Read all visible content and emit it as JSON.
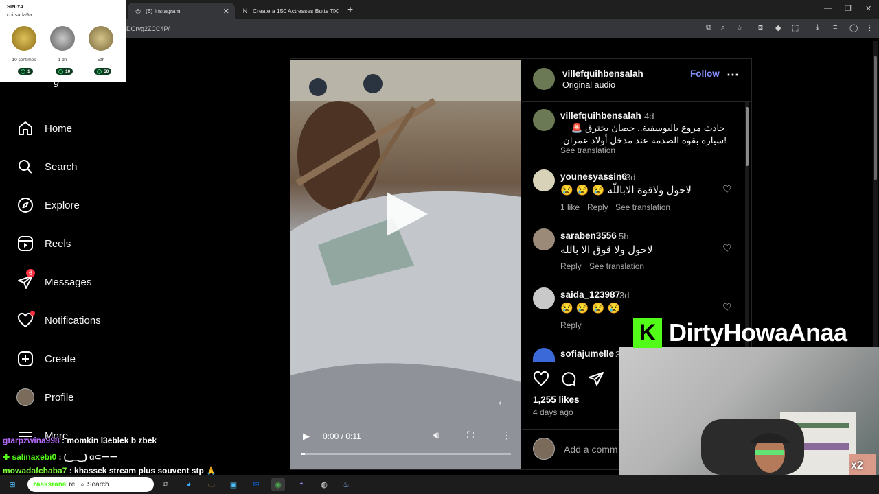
{
  "browser": {
    "tabs": [
      {
        "title": "(6) Instagram",
        "icon": "instagram-icon"
      },
      {
        "title": "Create a 150 Actresses Butts Ti",
        "icon": "notion-icon"
      }
    ],
    "url": "DOrvg2ZCC4P/"
  },
  "coins_overlay": {
    "title": "SINIYA",
    "subtitle": "chi sada9a",
    "coins": [
      {
        "label": "10 centimes",
        "count": "1",
        "color": "#c9a227"
      },
      {
        "label": "1 dh",
        "count": "10",
        "color": "#9a9a9a"
      },
      {
        "label": "5dh",
        "count": "50",
        "color": "#b8a36a"
      }
    ]
  },
  "sidebar": {
    "partial_logo": "g",
    "items": [
      {
        "label": "Home",
        "icon": "home-icon"
      },
      {
        "label": "Search",
        "icon": "search-icon"
      },
      {
        "label": "Explore",
        "icon": "compass-icon"
      },
      {
        "label": "Reels",
        "icon": "reels-icon"
      },
      {
        "label": "Messages",
        "icon": "send-icon",
        "badge": "6"
      },
      {
        "label": "Notifications",
        "icon": "heart-icon"
      },
      {
        "label": "Create",
        "icon": "plus-square-icon"
      },
      {
        "label": "Profile",
        "icon": "avatar"
      },
      {
        "label": "More",
        "icon": "menu-icon"
      }
    ]
  },
  "video": {
    "time": "0:00 / 0:11",
    "progress": 0.01
  },
  "post": {
    "author": "villefquihbensalah",
    "audio": "Original audio",
    "follow_label": "Follow",
    "caption": {
      "user": "villefquihbensalah",
      "age": "4d",
      "line1": "حادث مروع باليوسفية.. حصان يخترق 🚨",
      "line2": "!سيارة بقوة الصدمة عند مدخل أولاد عمران",
      "see_translation": "See translation"
    },
    "comments": [
      {
        "user": "younesyassin6",
        "age": "3d",
        "text": "😢 😢 😢 لاحول ولاقوة الاباللّه",
        "likes": "1 like",
        "reply": "Reply",
        "translate": "See translation"
      },
      {
        "user": "saraben3556",
        "age": "5h",
        "text": "لاحول ولا قوق الا بالله",
        "reply": "Reply",
        "translate": "See translation"
      },
      {
        "user": "saida_123987",
        "age": "3d",
        "text": "😢 😢 😢 😢",
        "reply": "Reply"
      },
      {
        "user": "sofiajumelle",
        "age": "3"
      }
    ],
    "likes": "1,255 likes",
    "date": "4 days ago",
    "add_comment_placeholder": "Add a comm"
  },
  "stream": {
    "brand_name": "DirtyHowaAnaa",
    "brand_color": "#53fc18",
    "cam_badge": "x2"
  },
  "chat": [
    {
      "user": "gtarpzwina998",
      "message": " : momkin l3eblek b zbek"
    },
    {
      "user": "salinaxebi0",
      "message": " : (‿_‿) ɑ⊂ーー"
    },
    {
      "user": "mowadafchaba7",
      "message": " : khassek stream plus souvent stp 🙏"
    },
    {
      "user": "zaaksrana",
      "message": "re"
    }
  ],
  "taskbar": {
    "search_placeholder": "Search"
  }
}
